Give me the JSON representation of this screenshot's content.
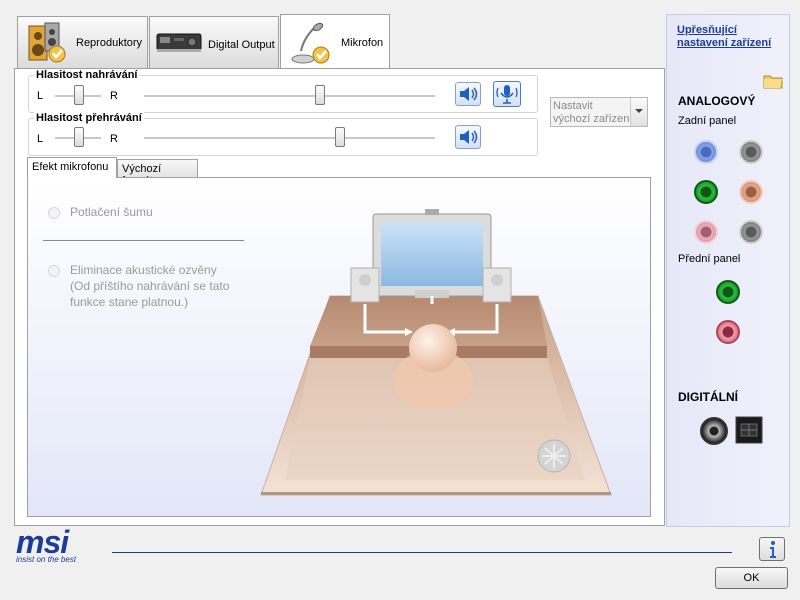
{
  "tabs": [
    {
      "label": "Reproduktory",
      "icon": "speaker-icon"
    },
    {
      "label": "Digital Output",
      "icon": "digital-device-icon"
    },
    {
      "label": "Mikrofon",
      "icon": "microphone-icon"
    }
  ],
  "recording": {
    "title": "Hlasitost nahrávání",
    "left": "L",
    "right": "R",
    "balance": 0.5,
    "volume": 0.6
  },
  "playback": {
    "title": "Hlasitost přehrávání",
    "left": "L",
    "right": "R",
    "balance": 0.5,
    "volume": 0.68
  },
  "default_device": {
    "label": "Nastavit\nvýchozí zařízení"
  },
  "subtabs": {
    "effect": "Efekt mikrofonu",
    "format": "Výchozí formát"
  },
  "effects": {
    "noise": "Potlačení šumu",
    "echo": "Eliminace akustické ozvěny\n(Od příštího nahrávání se tato\nfunkce stane platnou.)"
  },
  "right": {
    "link": "Upřesňující\nnastavení zařízení",
    "analog": "ANALOGOVÝ",
    "back_panel": "Zadní panel",
    "front_panel": "Přední panel",
    "digital": "DIGITÁLNÍ",
    "jack_colors": {
      "blue": "#6f8fd8",
      "gray": "#8a8a8a",
      "green": "#1e9c2c",
      "orange": "#d9967a",
      "pink": "#e39aa8"
    }
  },
  "footer": {
    "brand": "msi",
    "slogan": "insist on the best",
    "ok": "OK",
    "info_icon": "info-icon"
  }
}
